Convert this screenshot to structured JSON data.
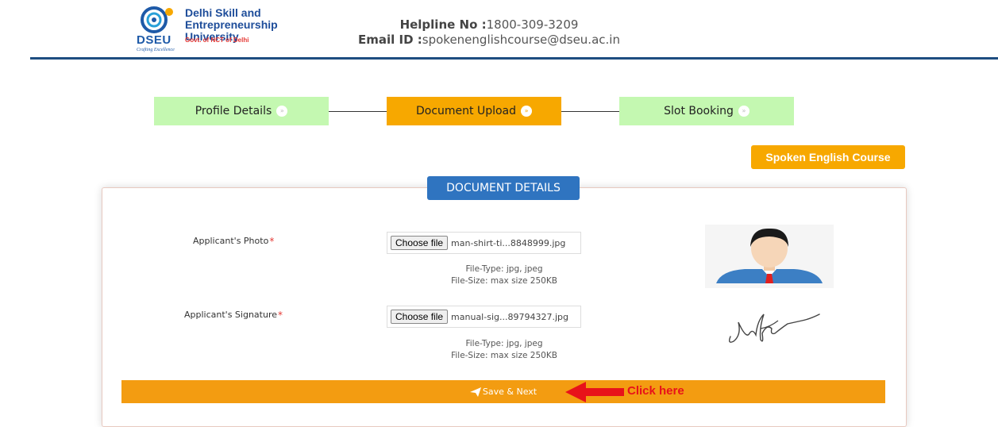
{
  "header": {
    "logo_name_line1": "Delhi Skill and",
    "logo_name_line2": "Entrepreneurship University",
    "logo_govt": "Govt. of NCT of Delhi",
    "logo_abbr": "DSEU",
    "logo_tagline": "Crafting Excellence",
    "helpline_label": "Helpline No :",
    "helpline_value": "1800-309-3209",
    "email_label": "Email ID :",
    "email_value": "spokenenglishcourse@dseu.ac.in"
  },
  "steps": [
    {
      "label": "Profile Details",
      "status": "completed",
      "icon": "chevron-right-icon"
    },
    {
      "label": "Document Upload",
      "status": "active",
      "icon": "chevron-right-icon"
    },
    {
      "label": "Slot Booking",
      "status": "pending",
      "icon": "chevron-right-icon"
    }
  ],
  "course_button": "Spoken English Course",
  "section_title": "DOCUMENT DETAILS",
  "fields": [
    {
      "label": "Applicant's Photo",
      "required_mark": "*",
      "choose_label": "Choose file",
      "file_name": "man-shirt-ti...8848999.jpg",
      "file_type": "File-Type: jpg, jpeg",
      "file_size": "File-Size: max size 250KB",
      "preview": "photo-preview"
    },
    {
      "label": "Applicant's Signature",
      "required_mark": "*",
      "choose_label": "Choose file",
      "file_name": "manual-sig...89794327.jpg",
      "file_type": "File-Type: jpg, jpeg",
      "file_size": "File-Size: max size 250KB",
      "preview": "signature-preview"
    }
  ],
  "save_button": "Save & Next",
  "annotation_text": "Click here",
  "colors": {
    "step_done": "#c4f8b1",
    "step_active": "#f7a800",
    "section_title_bg": "#2f74c0",
    "save_bar": "#f39c11",
    "annotation": "#e8121a",
    "header_rule": "#1e4d80"
  }
}
